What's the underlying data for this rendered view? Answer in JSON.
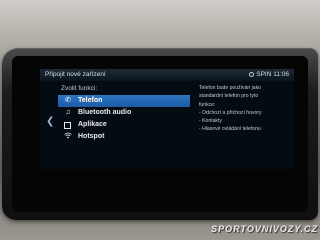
{
  "header": {
    "title": "Připojit nové zařízení",
    "status_icon": "spin-icon",
    "status_text": "SPIN 11:06"
  },
  "menu": {
    "title": "Zvolit funkci:",
    "items": [
      {
        "label": "Telefon",
        "icon": "phone-icon",
        "selected": true
      },
      {
        "label": "Bluetooth audio",
        "icon": "music-note-icon",
        "selected": false
      },
      {
        "label": "Aplikace",
        "icon": "checkbox-icon",
        "selected": false
      },
      {
        "label": "Hotspot",
        "icon": "wifi-icon",
        "selected": false
      }
    ]
  },
  "info": {
    "lines": [
      "Telefon bude používán jako",
      "standardní telefon pro tyto",
      "funkce:",
      "- Odchozí a příchozí hovory",
      "- Kontakty",
      "- Hlasové ovládání telefonu"
    ]
  },
  "watermark": "SPORTOVNIVOZY.CZ",
  "colors": {
    "selection": "#2f75c2",
    "screen_background": "#050b13",
    "text": "#e6eaef"
  }
}
